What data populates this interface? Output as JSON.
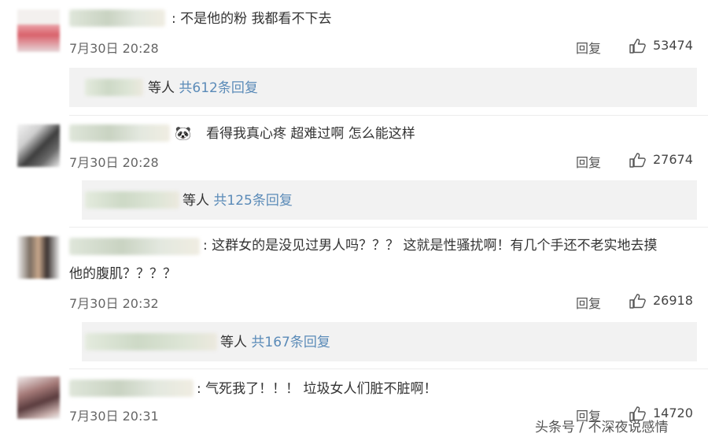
{
  "comments": [
    {
      "text": ": 不是他的粉 我都看不下去",
      "time": "7月30日 20:28",
      "reply_label": "回复",
      "likes": "53474",
      "sub_replies": {
        "prefix": "等人 ",
        "count_text": "共612条回复"
      }
    },
    {
      "text": "看得我真心疼  超难过啊  怎么能这样",
      "time": "7月30日 20:28",
      "reply_label": "回复",
      "likes": "27674",
      "sub_replies": {
        "prefix": "等人 ",
        "count_text": "共125条回复"
      }
    },
    {
      "text_line1": ": 这群女的是没见过男人吗？？？ 这就是性骚扰啊！有几个手还不老实地去摸",
      "text_line2": "他的腹肌？？？？",
      "time": "7月30日 20:32",
      "reply_label": "回复",
      "likes": "26918",
      "sub_replies": {
        "prefix": "等人 ",
        "count_text": "共167条回复"
      }
    },
    {
      "text": ": 气死我了！！！ 垃圾女人们脏不脏啊！",
      "time": "7月30日 20:31",
      "reply_label": "回复",
      "likes": "14720"
    }
  ],
  "watermark": "头条号 / 不深夜说感情",
  "icons": {
    "like": "thumbs-up-icon",
    "emoji": "panda-emoji-icon"
  },
  "colors": {
    "link": "#5b8bb8",
    "reply_bg": "#f2f2f2",
    "text": "#333333",
    "meta": "#666666"
  }
}
